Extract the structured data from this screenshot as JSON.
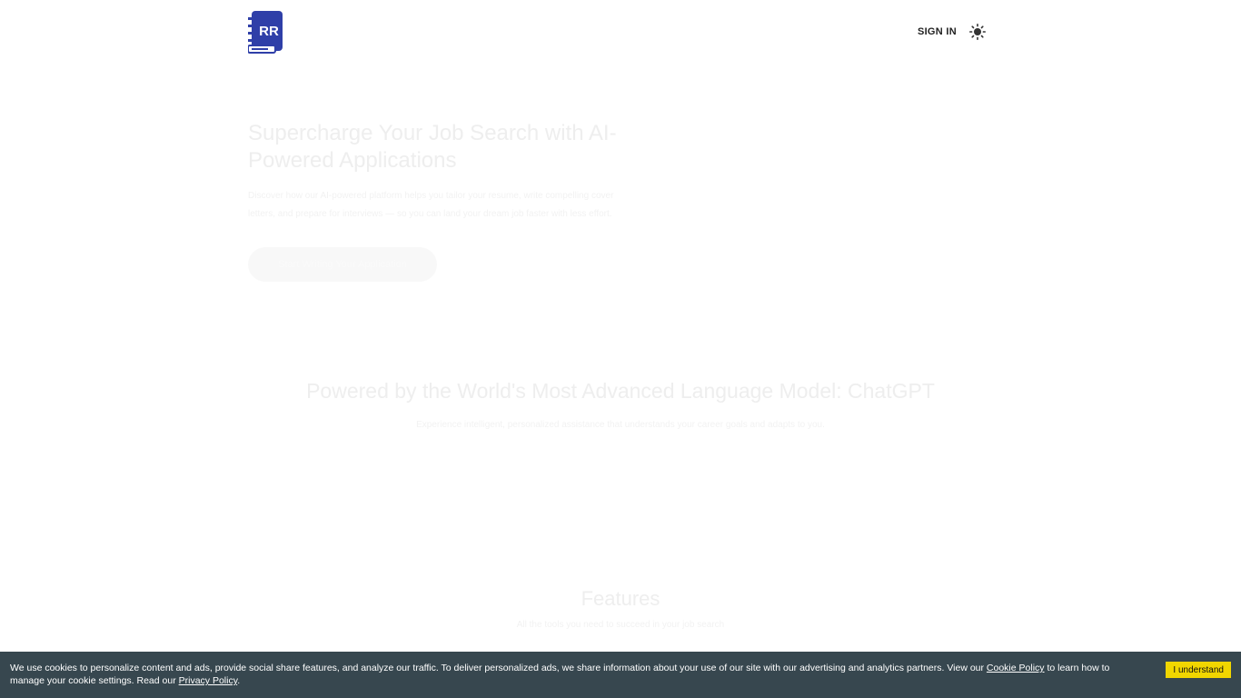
{
  "header": {
    "logo_text": "RR",
    "signin_label": "SIGN IN",
    "theme_icon": "sun-icon"
  },
  "hero": {
    "title": "Supercharge Your Job Search with AI-Powered Applications",
    "description": "Discover how our AI-powered platform helps you tailor your resume, write compelling cover letters, and prepare for interviews — so you can land your dream job faster with less effort.",
    "cta_label": "Start Writing Your Application"
  },
  "powered": {
    "title": "Powered by the World's Most Advanced Language Model: ChatGPT",
    "description": "Experience intelligent, personalized assistance that understands your career goals and adapts to you."
  },
  "features": {
    "title": "Features",
    "subtitle": "All the tools you need to succeed in your job search"
  },
  "cookie": {
    "text_1": "We use cookies to personalize content and ads, provide social share features, and analyze our traffic. To deliver personalized ads, we share information about your use of our site with our advertising and analytics partners. View our ",
    "cookie_policy_link": "Cookie Policy",
    "text_2": " to learn how to manage your cookie settings. Read our ",
    "privacy_policy_link": "Privacy Policy",
    "text_3": ".",
    "accept_label": "I understand"
  },
  "colors": {
    "brand": "#2f3fa8",
    "cookie_bg": "#37474f",
    "cookie_button": "#f1d600"
  }
}
